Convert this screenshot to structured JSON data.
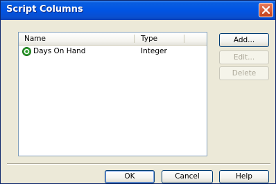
{
  "window": {
    "title": "Script Columns"
  },
  "list": {
    "columns": [
      "Name",
      "Type"
    ],
    "rows": [
      {
        "name": "Days On Hand",
        "type": "Integer"
      }
    ]
  },
  "side_buttons": {
    "add": "Add...",
    "edit": "Edit...",
    "delete": "Delete"
  },
  "footer_buttons": {
    "ok": "OK",
    "cancel": "Cancel",
    "help": "Help"
  }
}
